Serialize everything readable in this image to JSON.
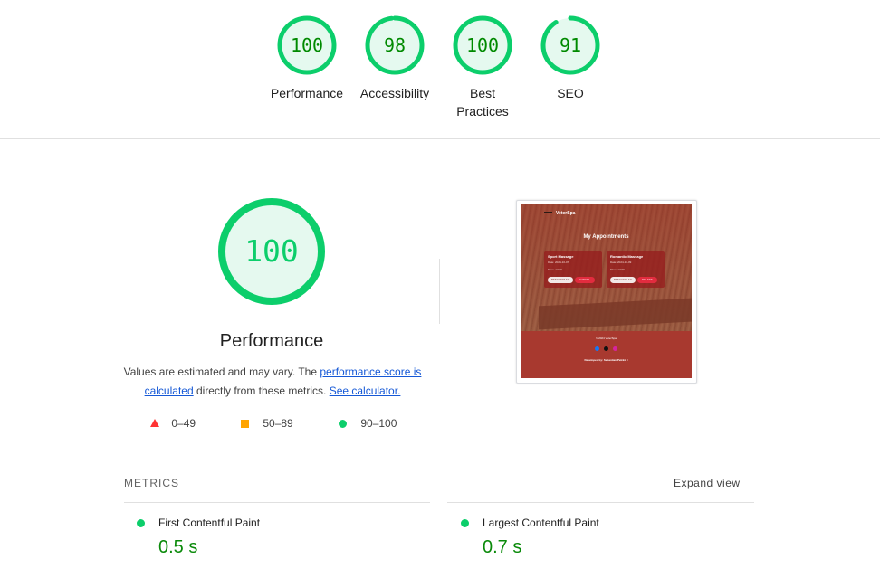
{
  "top_scores": [
    {
      "value": "100",
      "label": "Performance",
      "score": 100
    },
    {
      "value": "98",
      "label": "Accessibility",
      "score": 98
    },
    {
      "value": "100",
      "label": "Best Practices",
      "score": 100
    },
    {
      "value": "91",
      "label": "SEO",
      "score": 91
    }
  ],
  "main": {
    "score": "100",
    "score_value": 100,
    "title": "Performance",
    "desc_prefix": "Values are estimated and may vary. The ",
    "desc_link1": "performance score is calculated",
    "desc_middle": " directly from these metrics. ",
    "desc_link2": "See calculator.",
    "legend": [
      {
        "icon": "triangle-icon",
        "label": "0–49",
        "color": "#ff3333"
      },
      {
        "icon": "square-icon",
        "label": "50–89",
        "color": "#ffa400"
      },
      {
        "icon": "circle-icon",
        "label": "90–100",
        "color": "#0cce6b"
      }
    ]
  },
  "screenshot": {
    "brand": "VeterSpa",
    "heading": "My Appointments",
    "cards": [
      {
        "title": "Sport Massage",
        "line1": "Date: 2024-10-07",
        "line2": "Time: 12:00",
        "btn1": "RESCHEDULE",
        "btn2": "CANCEL"
      },
      {
        "title": "Romantic Massage",
        "line1": "Date: 2024-10-09",
        "line2": "Time: 12:00",
        "btn1": "RESCHEDULE",
        "btn2": "DELETE"
      }
    ],
    "copyright": "© 2024 VeterSpa",
    "developer": "Developed by: Sebastian Petráš II"
  },
  "metrics": {
    "heading": "METRICS",
    "expand_label": "Expand view",
    "items": [
      {
        "name": "First Contentful Paint",
        "value": "0.5 s"
      },
      {
        "name": "Largest Contentful Paint",
        "value": "0.7 s"
      }
    ]
  },
  "colors": {
    "pass": "#0cce6b",
    "pass_text": "#008a00",
    "gauge_bg": "#e5f9ef"
  }
}
